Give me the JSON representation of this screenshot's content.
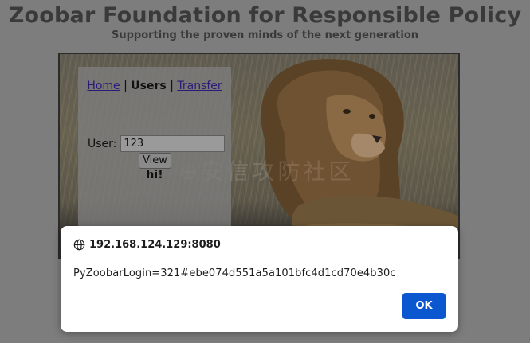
{
  "page": {
    "title": "Zoobar Foundation for Responsible Policy",
    "subtitle": "Supporting the proven minds of the next generation"
  },
  "nav": {
    "home": "Home",
    "users": "Users",
    "transfer": "Transfer",
    "separator": "|"
  },
  "users_form": {
    "label": "User:",
    "input_value": "123",
    "button_label": "View",
    "result": "hi!"
  },
  "watermark": "⊕安信攻防社区",
  "dialog": {
    "origin": "192.168.124.129:8080",
    "message": "PyZoobarLogin=321#ebe074d551a5a101bfc4d1cd70e4b30c",
    "ok_label": "OK"
  },
  "colors": {
    "overlay_background": "#7d7d7d",
    "ok_button": "#0b57d0",
    "link": "#2a1a7a"
  }
}
